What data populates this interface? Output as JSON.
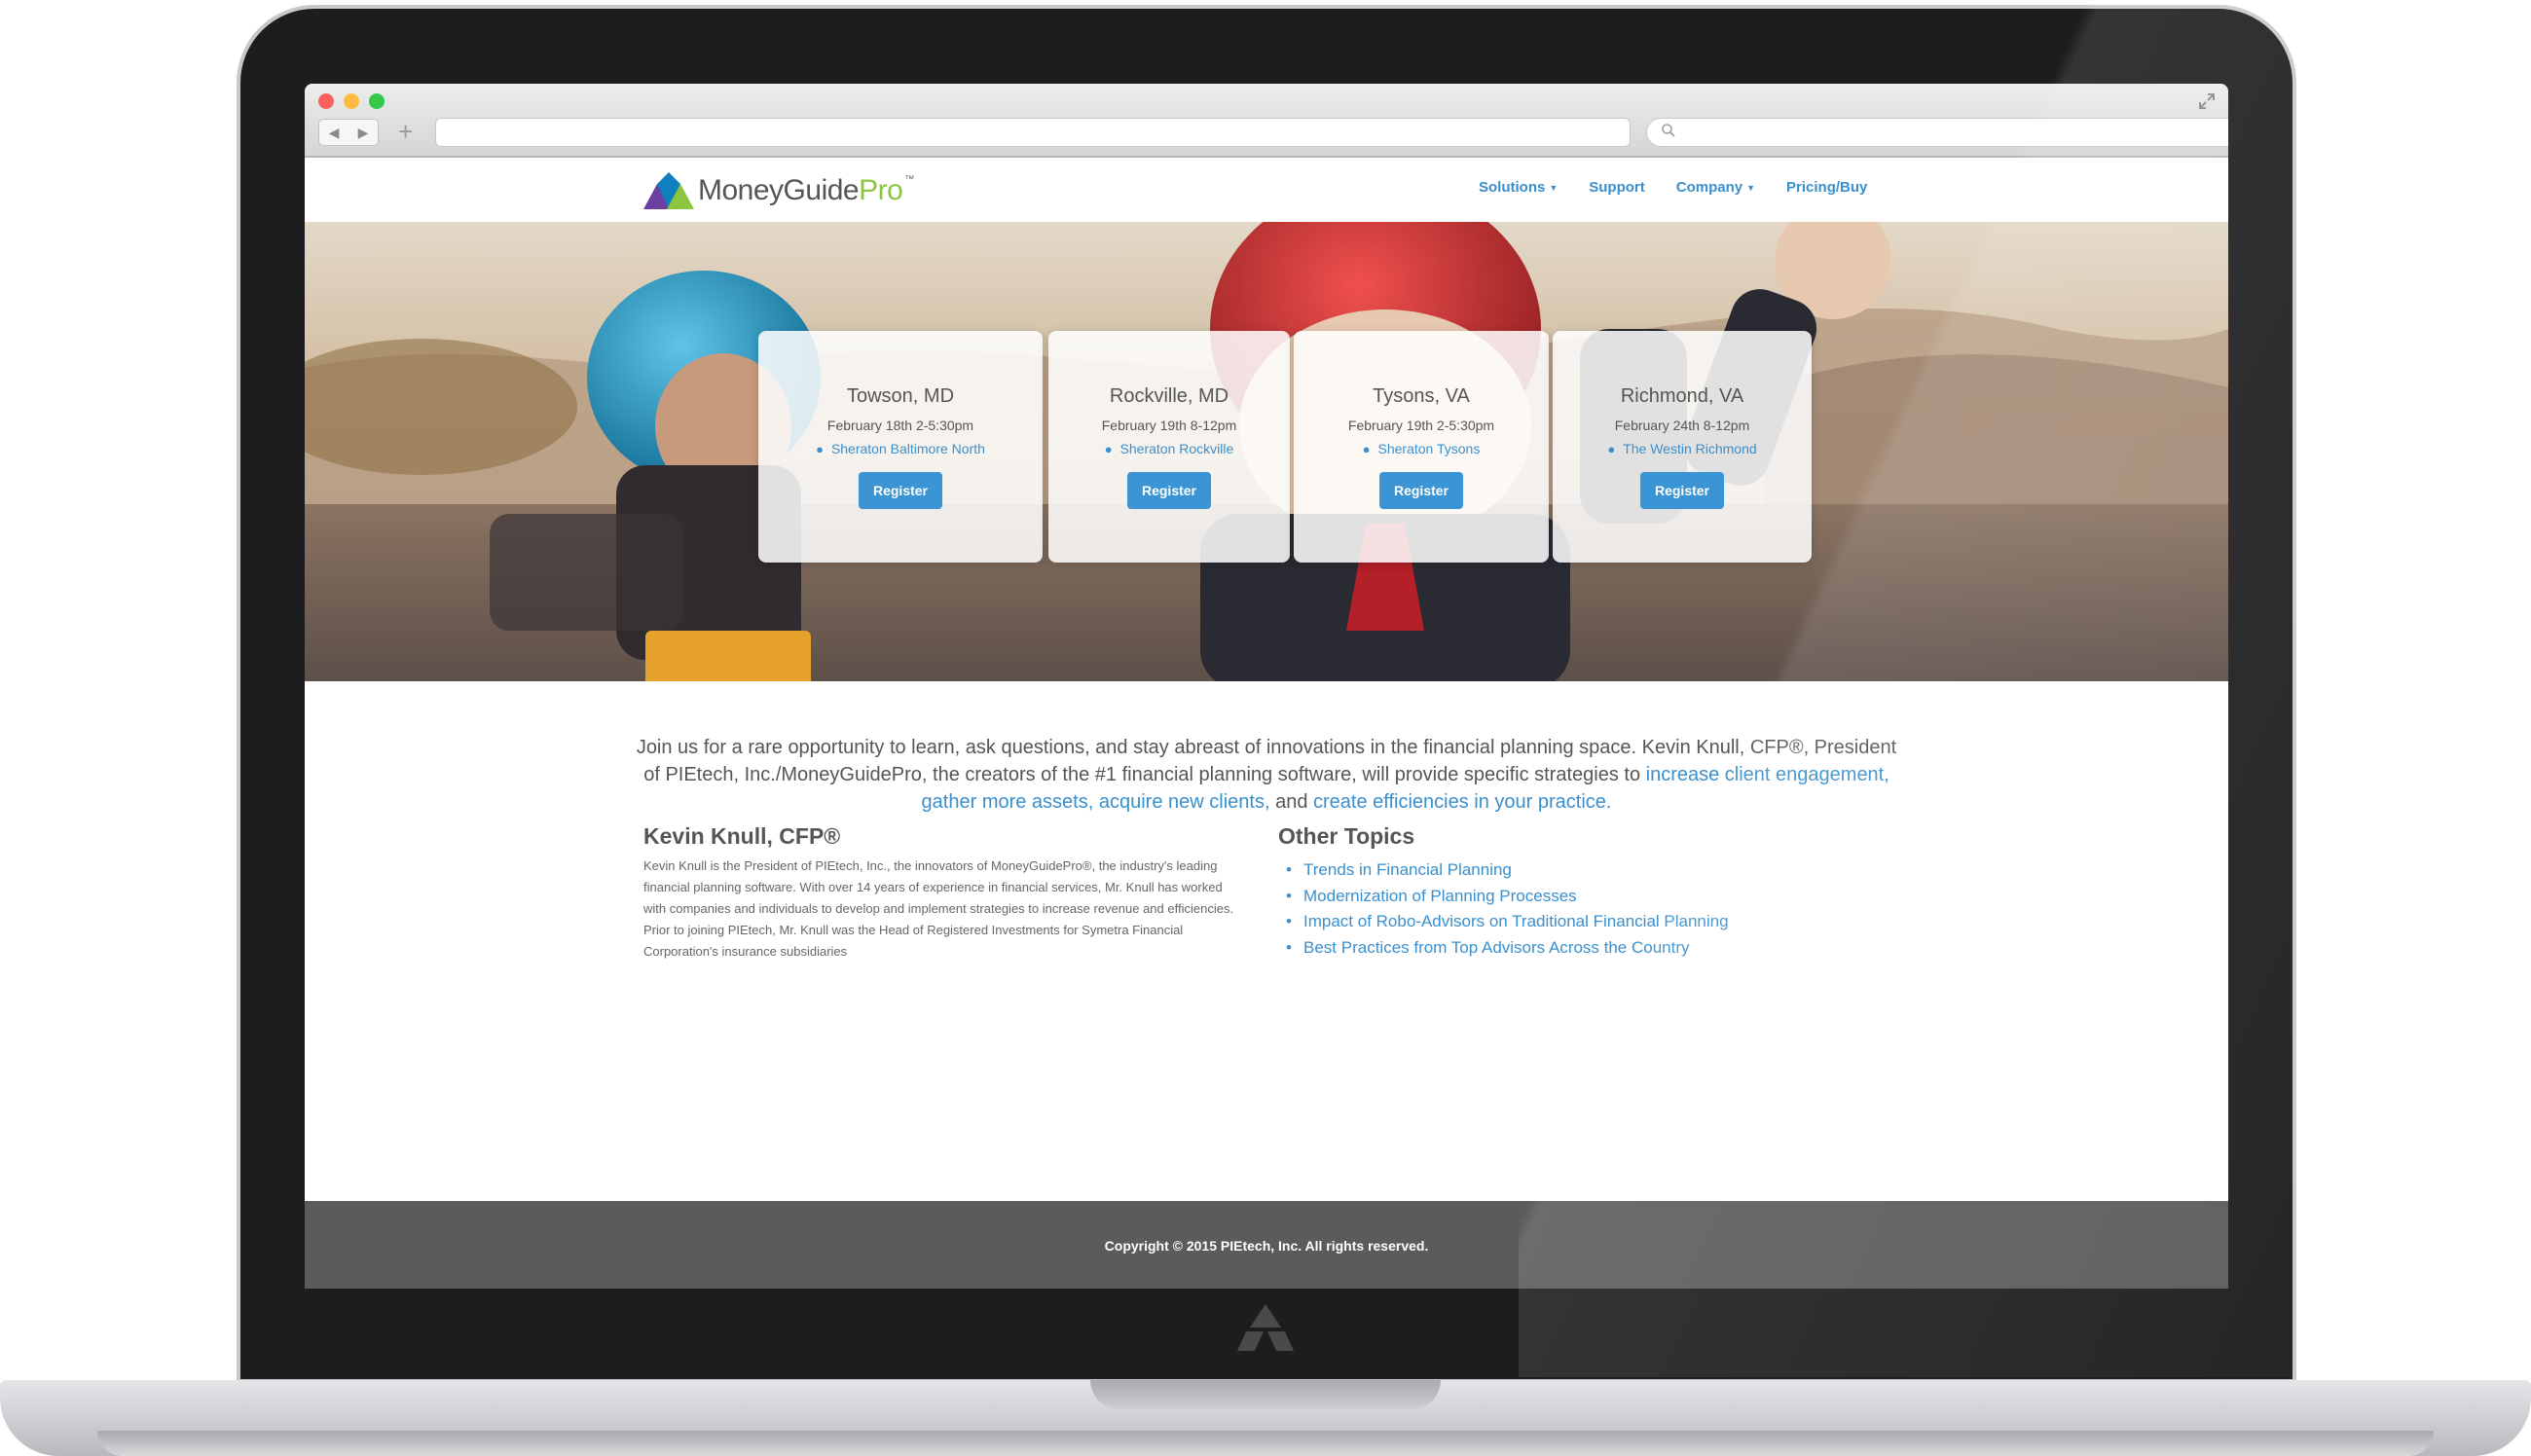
{
  "browser": {
    "back_icon": "back-arrow-icon",
    "forward_icon": "forward-arrow-icon",
    "new_tab": "+",
    "search_icon": "magnifier-icon",
    "fullscreen_icon": "expand-icon"
  },
  "header": {
    "logo_text_main": "MoneyGuide",
    "logo_text_accent": "Pro",
    "logo_tm": "™",
    "nav": [
      {
        "label": "Solutions",
        "has_dropdown": true
      },
      {
        "label": "Support",
        "has_dropdown": false
      },
      {
        "label": "Company",
        "has_dropdown": true
      },
      {
        "label": "Pricing/Buy",
        "has_dropdown": false
      }
    ],
    "accent_color": "#3a8fcc",
    "brand_green": "#8cc63f"
  },
  "events": [
    {
      "city": "Towson, MD",
      "date": "February 18th 2-5:30pm",
      "venue": "Sheraton Baltimore North",
      "button": "Register"
    },
    {
      "city": "Rockville, MD",
      "date": "February 19th 8-12pm",
      "venue": "Sheraton Rockville",
      "button": "Register"
    },
    {
      "city": "Tysons, VA",
      "date": "February 19th 2-5:30pm",
      "venue": "Sheraton Tysons",
      "button": "Register"
    },
    {
      "city": "Richmond, VA",
      "date": "February 24th 8-12pm",
      "venue": "The Westin Richmond",
      "button": "Register"
    }
  ],
  "intro": {
    "text_1": "Join us for a rare opportunity to learn, ask questions, and stay abreast of innovations in the financial planning space. Kevin Knull, CFP®, President of PIEtech, Inc./MoneyGuidePro, the creators of the #1 financial planning software, will provide specific strategies to ",
    "link_1": "increase client engagement,",
    "text_2": " ",
    "link_2": "gather more assets,",
    "text_3": " ",
    "link_3": "acquire new clients,",
    "text_4": " and ",
    "link_4": "create efficiencies in your practice.",
    "text_5": ""
  },
  "bio": {
    "title": "Kevin Knull, CFP®",
    "text": "Kevin Knull is the President of PIEtech, Inc., the innovators of MoneyGuidePro®, the industry's leading financial planning software. With over 14 years of experience in financial services, Mr. Knull has worked with companies and individuals to develop and implement strategies to increase revenue and efficiencies. Prior to joining PIEtech, Mr. Knull was the Head of Registered Investments for Symetra Financial Corporation's insurance subsidiaries"
  },
  "topics": {
    "title": "Other Topics",
    "items": [
      "Trends in Financial Planning",
      "Modernization of Planning Processes",
      "Impact of Robo-Advisors on Traditional Financial Planning",
      "Best Practices from Top Advisors Across the Country"
    ]
  },
  "footer": {
    "copyright": "Copyright © 2015 PIEtech, Inc. All rights reserved."
  }
}
